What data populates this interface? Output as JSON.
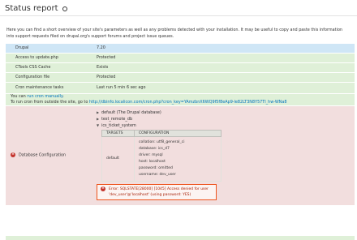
{
  "header": {
    "title": "Status report",
    "icon": "gear-icon"
  },
  "intro": "Here you can find a short overview of your site's parameters as well as any problems detected with your installation. It may be useful to copy and paste this information into support requests filed on drupal.org's support forums and project issue queues.",
  "rows": {
    "drupal": {
      "label": "Drupal",
      "value": "7.20"
    },
    "update": {
      "label": "Access to update.php",
      "value": "Protected"
    },
    "ctools": {
      "label": "CTools CSS Cache",
      "value": "Exists"
    },
    "config": {
      "label": "Configuration file",
      "value": "Protected"
    },
    "cron": {
      "label": "Cron maintenance tasks",
      "value": "Last run 5 min 6 sec ago",
      "run_text": "You can ",
      "run_link": "run cron manually",
      "run_suffix": ".",
      "outside_text": "To run cron from outside the site, go to ",
      "outside_link": "http://dbinfo.localicon.com/cron.php?cron_key=YAmzbnX6WQ9f5f8eAp9-le82LT3N8Y57TI_hw-WNa8"
    },
    "db": {
      "label": "Database Configuration",
      "databases": [
        {
          "name": "default (The Drupal database)",
          "expanded": false
        },
        {
          "name": "test_remote_db",
          "expanded": false
        },
        {
          "name": "ics_ticket_system",
          "expanded": true
        }
      ],
      "targets_header": "TARGETS",
      "configuration_header": "CONFIGURATION",
      "target": "default",
      "configuration": [
        "collation: utf8_general_ci",
        "database: ics_d7",
        "driver: mysql",
        "host: localhost",
        "password: omitted",
        "username: dev_user"
      ],
      "error": "Error: SQLSTATE[28000] [1045] Access denied for user 'dev_user'@'localhost' (using password: YES)"
    }
  },
  "colors": {
    "ok_bg": "#dff0d8",
    "info_bg": "#cfe6f6",
    "error_bg": "#f2dede",
    "error_icon": "#c4342d",
    "link": "#0074bd"
  }
}
